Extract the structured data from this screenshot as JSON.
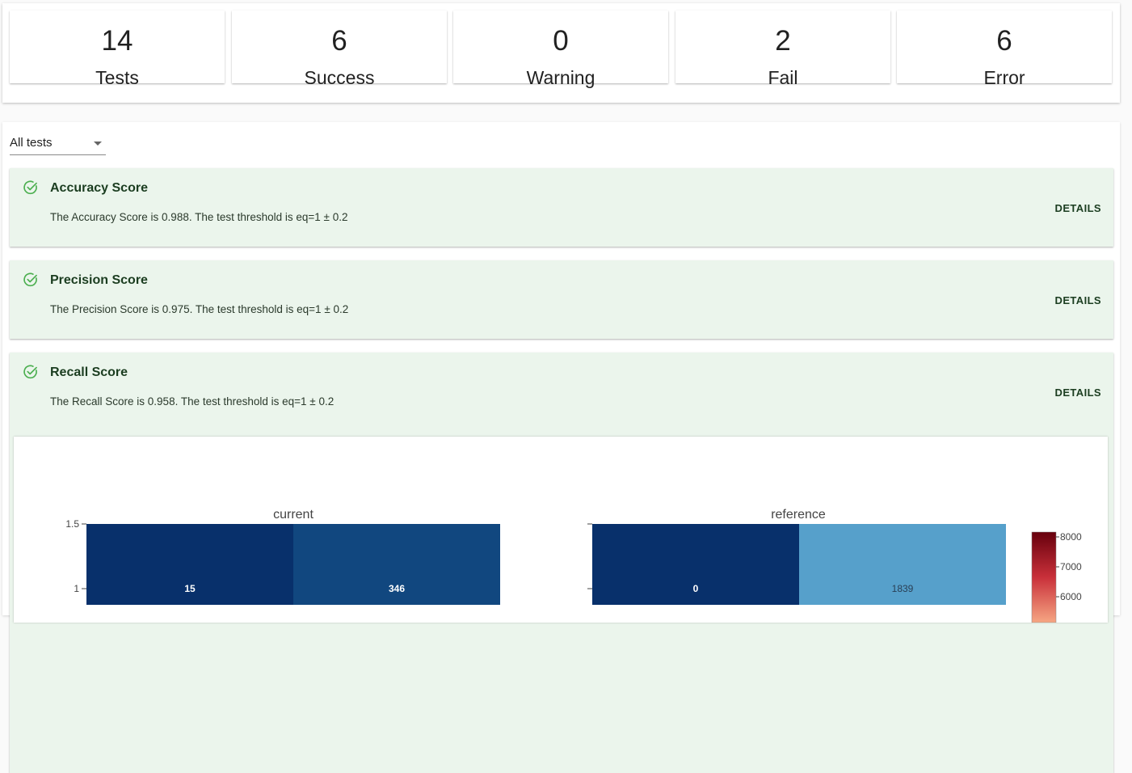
{
  "summary": {
    "stats": [
      {
        "value": "14",
        "label": "Tests"
      },
      {
        "value": "6",
        "label": "Success"
      },
      {
        "value": "0",
        "label": "Warning"
      },
      {
        "value": "2",
        "label": "Fail"
      },
      {
        "value": "6",
        "label": "Error"
      }
    ]
  },
  "filter": {
    "selected": "All tests"
  },
  "tests": [
    {
      "title": "Accuracy Score",
      "description": "The Accuracy Score is 0.988. The test threshold is eq=1 ± 0.2",
      "details_label": "DETAILS",
      "status_icon": "check-circle-icon"
    },
    {
      "title": "Precision Score",
      "description": "The Precision Score is 0.975. The test threshold is eq=1 ± 0.2",
      "details_label": "DETAILS",
      "status_icon": "check-circle-icon"
    },
    {
      "title": "Recall Score",
      "description": "The Recall Score is 0.958. The test threshold is eq=1 ± 0.2",
      "details_label": "DETAILS",
      "status_icon": "check-circle-icon"
    }
  ],
  "colors": {
    "success_bg": "#ebf5ec",
    "success_icon": "#4caf50"
  },
  "chart_data": [
    {
      "type": "heatmap",
      "title": "current",
      "y_ticks": [
        "1.5",
        "1"
      ],
      "cells": [
        {
          "value": 15,
          "color": "#08306b"
        },
        {
          "value": 346,
          "color": "#11477f"
        }
      ]
    },
    {
      "type": "heatmap",
      "title": "reference",
      "cells": [
        {
          "value": 0,
          "color": "#08306b"
        },
        {
          "value": 1839,
          "color": "#56a0cb"
        }
      ],
      "colorbar": {
        "ticks": [
          "8000",
          "7000",
          "6000"
        ],
        "colors": [
          "#67000d",
          "#c9303a",
          "#f6a683"
        ]
      }
    }
  ]
}
